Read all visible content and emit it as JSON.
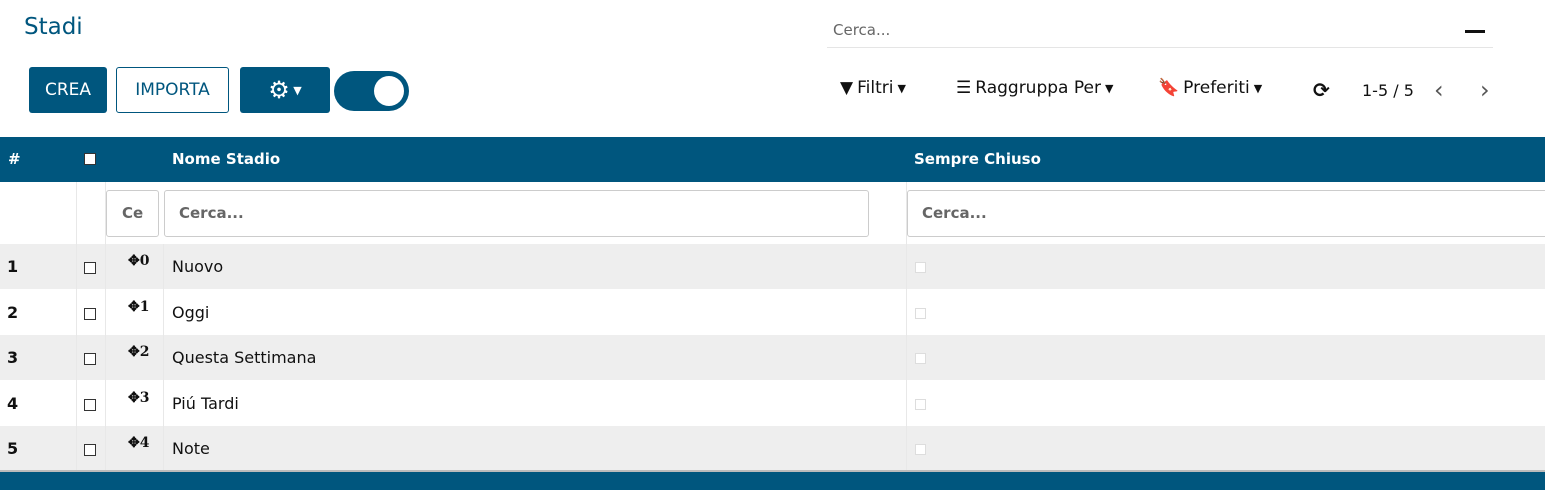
{
  "title": "Stadi",
  "search_placeholder": "Cerca...",
  "buttons": {
    "create": "CREA",
    "import": "IMPORTA"
  },
  "toolbar": {
    "filters": "Filtri",
    "group_by": "Raggruppa Per",
    "favorites": "Preferiti",
    "pager": "1-5 / 5"
  },
  "table": {
    "headers": {
      "num": "#",
      "name": "Nome Stadio",
      "closed": "Sempre Chiuso"
    },
    "filter_short": "Ce",
    "filter_placeholder": "Cerca...",
    "rows": [
      {
        "num": "1",
        "seq": "0",
        "name": "Nuovo"
      },
      {
        "num": "2",
        "seq": "1",
        "name": "Oggi"
      },
      {
        "num": "3",
        "seq": "2",
        "name": "Questa Settimana"
      },
      {
        "num": "4",
        "seq": "3",
        "name": "Piú Tardi"
      },
      {
        "num": "5",
        "seq": "4",
        "name": "Note"
      }
    ]
  }
}
